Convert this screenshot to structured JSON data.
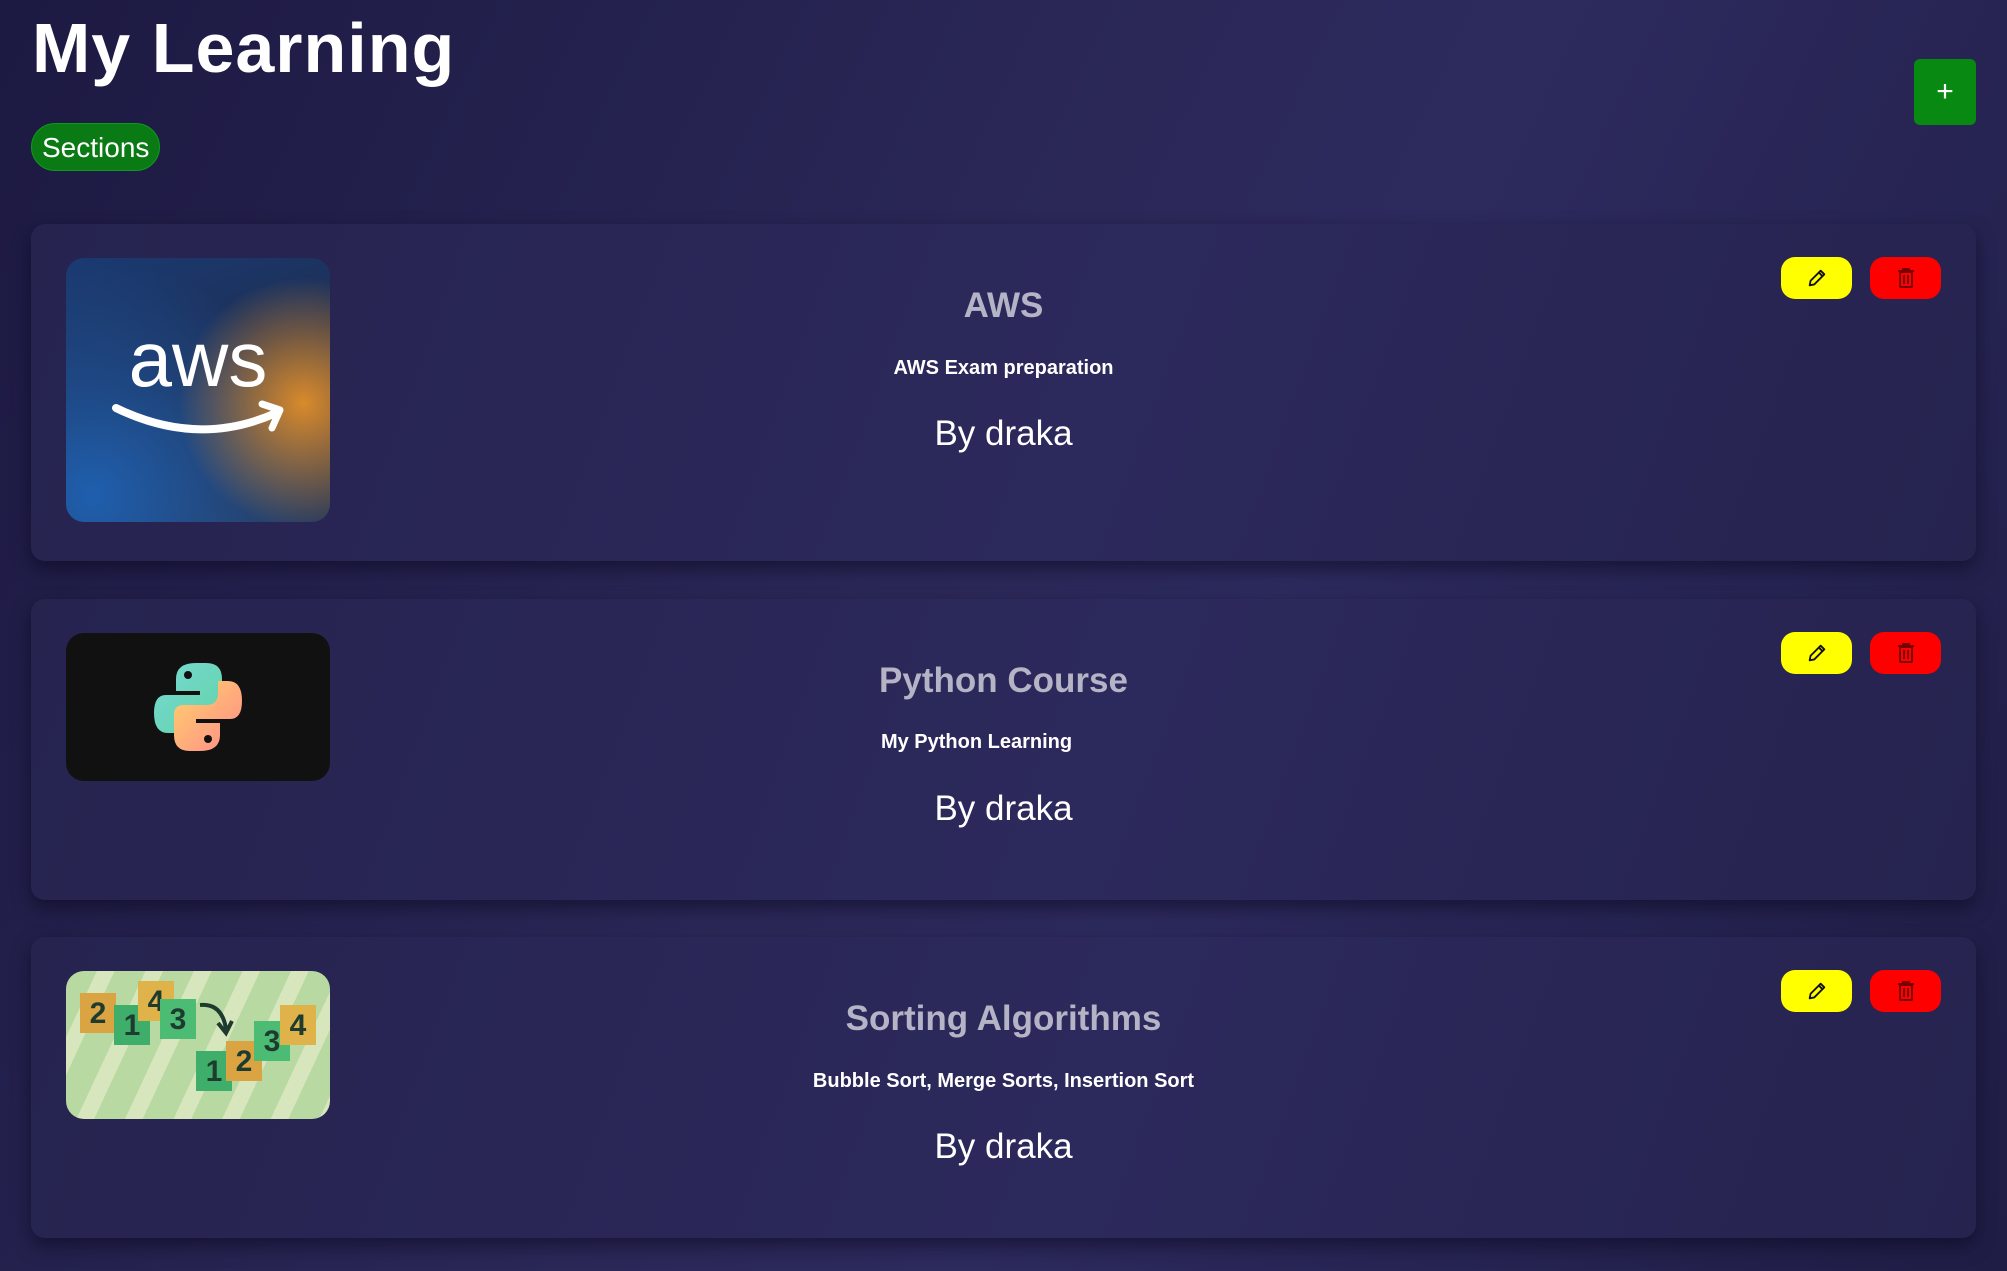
{
  "header": {
    "title": "My Learning",
    "sections_label": "Sections",
    "add_label": "+"
  },
  "colors": {
    "accent_green": "#0a7a14",
    "edit_yellow": "#ffff00",
    "delete_red": "#ff0000"
  },
  "courses": [
    {
      "title": "AWS",
      "description": "AWS Exam preparation",
      "author": "By draka",
      "thumbnail_icon": "aws-logo-icon",
      "thumbnail_text": "aws"
    },
    {
      "title": "Python Course",
      "description": "My Python Learning",
      "author": "By draka",
      "thumbnail_icon": "python-logo-icon"
    },
    {
      "title": "Sorting Algorithms",
      "description": "Bubble Sort, Merge Sorts, Insertion Sort",
      "author": "By draka",
      "thumbnail_icon": "sorting-blocks-icon"
    }
  ],
  "card_actions": {
    "edit_icon": "pencil-icon",
    "delete_icon": "trash-icon"
  }
}
